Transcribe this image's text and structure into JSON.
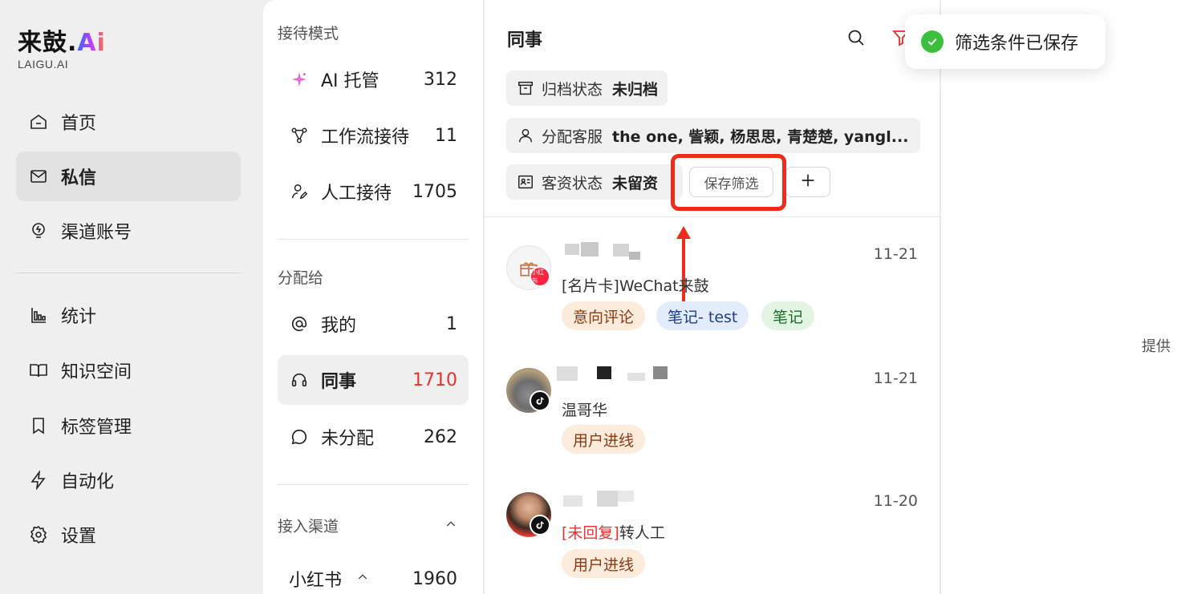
{
  "brand": {
    "logo_text": "来鼓.",
    "logo_ai": "Ai",
    "logo_sub": "LAIGU.AI"
  },
  "nav": {
    "items": [
      {
        "label": "首页",
        "icon": "home-icon"
      },
      {
        "label": "私信",
        "icon": "mail-icon",
        "active": true
      },
      {
        "label": "渠道账号",
        "icon": "bulb-icon"
      },
      {
        "label": "统计",
        "icon": "chart-icon"
      },
      {
        "label": "知识空间",
        "icon": "book-icon"
      },
      {
        "label": "标签管理",
        "icon": "bookmark-icon"
      },
      {
        "label": "自动化",
        "icon": "lightning-icon"
      },
      {
        "label": "设置",
        "icon": "gear-icon"
      }
    ]
  },
  "modes": {
    "section_title": "接待模式",
    "items": [
      {
        "label": "AI 托管",
        "count": "312"
      },
      {
        "label": "工作流接待",
        "count": "11"
      },
      {
        "label": "人工接待",
        "count": "1705"
      }
    ]
  },
  "assign": {
    "section_title": "分配给",
    "items": [
      {
        "label": "我的",
        "count": "1"
      },
      {
        "label": "同事",
        "count": "1710"
      },
      {
        "label": "未分配",
        "count": "262"
      }
    ]
  },
  "channels": {
    "section_title": "接入渠道",
    "items": [
      {
        "label": "小红书",
        "count": "1960"
      }
    ]
  },
  "list": {
    "title": "同事",
    "filters": [
      {
        "key": "归档状态",
        "value": "未归档"
      },
      {
        "key": "分配客服",
        "value": "the one, 訾颖, 杨思思, 青楚楚, yangl..."
      },
      {
        "key": "客资状态",
        "value": "未留资"
      }
    ],
    "save_filter_label": "保存筛选",
    "conversations": [
      {
        "date": "11-21",
        "message": "[名片卡]WeChat来鼓",
        "message_prefix": "",
        "channel": "小红书",
        "tags": [
          "意向评论",
          "笔记- test",
          "笔记"
        ]
      },
      {
        "date": "11-21",
        "message": "温哥华",
        "message_prefix": "",
        "channel": "抖音",
        "tags": [
          "用户进线"
        ]
      },
      {
        "date": "11-20",
        "message": "转人工",
        "message_prefix": "[未回复]",
        "channel": "抖音",
        "tags": [
          "用户进线"
        ]
      }
    ]
  },
  "detail": {
    "hint": "提供"
  },
  "toast": {
    "text": "筛选条件已保存"
  },
  "colors": {
    "accent_red": "#e5322d",
    "highlight_red": "#ef2b1c",
    "success_green": "#3cbf3c"
  }
}
